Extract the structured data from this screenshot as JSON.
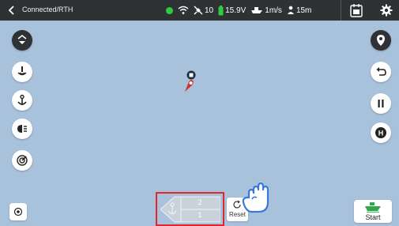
{
  "topbar": {
    "title": "Connected/RTH",
    "satellites": "10",
    "voltage": "15.9V",
    "speed": "1m/s",
    "distance": "15m"
  },
  "controls": {
    "reset_label": "Reset",
    "start_label": "Start"
  },
  "hull": {
    "top_number": "2",
    "bottom_number": "1"
  },
  "icons": {
    "left": [
      "home-return-icon",
      "sonar-icon",
      "anchor-icon",
      "headlight-icon",
      "radar-icon"
    ],
    "right": [
      "location-pin-icon",
      "return-arrow-icon",
      "pause-icon",
      "home-h-icon"
    ]
  },
  "colors": {
    "map_background": "#a9c2dc",
    "topbar": "#2f3235",
    "status_ok": "#2ecc40",
    "highlight": "#e2262b",
    "boat_marker": "#d0312d",
    "hand_pointer": "#3a78d8"
  }
}
